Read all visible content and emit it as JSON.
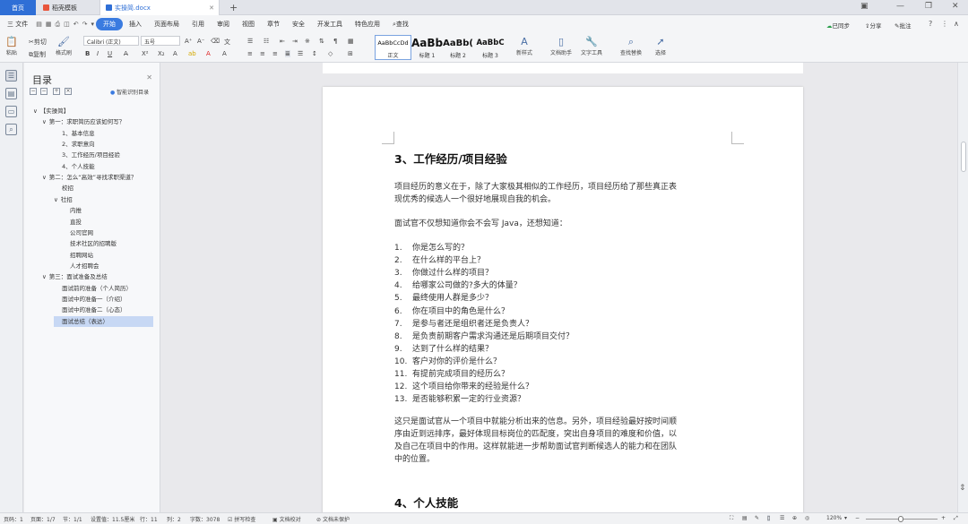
{
  "tabs": {
    "home": "首页",
    "t1": "稻壳模板",
    "t2": "实操简.docx"
  },
  "menu": {
    "file": "三 文件",
    "items": [
      "开始",
      "插入",
      "页面布局",
      "引用",
      "审阅",
      "视图",
      "章节",
      "安全",
      "开发工具",
      "特色应用"
    ],
    "search": "查找",
    "right": [
      "已同步",
      "分享",
      "批注"
    ]
  },
  "toolbar": {
    "paste": "粘贴",
    "cut": "剪切",
    "copy": "复制",
    "format_painter": "格式刷",
    "font_name": "Calibri (正文)",
    "font_size": "五号",
    "styles": [
      {
        "sample": "AaBbCcDd",
        "label": "正文"
      },
      {
        "sample": "AaBb",
        "label": "标题 1"
      },
      {
        "sample": "AaBb(",
        "label": "标题 2"
      },
      {
        "sample": "AaBbC",
        "label": "标题 3"
      }
    ],
    "new_style": "新样式",
    "doc_helper": "文档助手",
    "text_tools": "文字工具",
    "find_replace": "查找替换",
    "select": "选择"
  },
  "nav": {
    "title": "目录",
    "smart": "智能识别目录",
    "items": [
      {
        "text": "【实操简】",
        "level": 0,
        "toggle": "∨"
      },
      {
        "text": "第一：求职简历应该如何写？",
        "level": 1,
        "toggle": "∨"
      },
      {
        "text": "1、基本信息",
        "level": 2
      },
      {
        "text": "2、求职意向",
        "level": 2
      },
      {
        "text": "3、工作经历/项目经验",
        "level": 2
      },
      {
        "text": "4、个人技能",
        "level": 2
      },
      {
        "text": "第二：怎么“高效”寻找求职渠道？",
        "level": 1,
        "toggle": "∨"
      },
      {
        "text": "校招",
        "level": 2
      },
      {
        "text": "社招",
        "level": 2,
        "toggle": "∨"
      },
      {
        "text": "内推",
        "level": 3
      },
      {
        "text": "直投",
        "level": 3
      },
      {
        "text": "公司官网",
        "level": 3
      },
      {
        "text": "技术社区的招聘版",
        "level": 3
      },
      {
        "text": "招聘网站",
        "level": 3
      },
      {
        "text": "人才招聘会",
        "level": 3
      },
      {
        "text": "第三：面试准备及总结",
        "level": 1,
        "toggle": "∨"
      },
      {
        "text": "面试前的准备（个人简历）",
        "level": 2
      },
      {
        "text": "面试中的准备一（介绍）",
        "level": 2
      },
      {
        "text": "面试中的准备二（心态）",
        "level": 2
      },
      {
        "text": "面试总结（表达）",
        "level": 2,
        "selected": true
      }
    ]
  },
  "document": {
    "heading3": "3、工作经历/项目经验",
    "para1_l1": "项目经历的意义在于，除了大家极其相似的工作经历，项目经历给了那些真正表",
    "para1_l2": "现优秀的候选人一个很好地展现自我的机会。",
    "para2": "面试官不仅想知道你会不会写 Java，还想知道：",
    "list": [
      "你是怎么写的？",
      "在什么样的平台上？",
      "你做过什么样的项目？",
      "给哪家公司做的?多大的体量？",
      "最终使用人群是多少？",
      "你在项目中的角色是什么？",
      "是参与者还是组织者还是负责人？",
      "是负责前期客户需求沟通还是后期项目交付？",
      "达到了什么样的结果？",
      "客户对你的评价是什么？",
      "有提前完成项目的经历么？",
      "这个项目给你带来的经验是什么？",
      "是否能够积累一定的行业资源？"
    ],
    "para3_l1": "这只是面试官从一个项目中就能分析出来的信息。另外，项目经验最好按时间顺",
    "para3_l2": "序由近到远排序，最好体现目标岗位的匹配度，突出自身项目的难度和价值，以",
    "para3_l3": "及自己在项目中的作用。这样就能进一步帮助面试官判断候选人的能力和在团队",
    "para3_l4": "中的位置。",
    "heading4": "4、个人技能"
  },
  "status": {
    "page": "页码：1",
    "pages": "页面：1/7",
    "section": "节：1/1",
    "setting": "设置值：11.5厘米",
    "row": "行：11",
    "col": "列：2",
    "words": "字数：3078",
    "spell": "拼写检查",
    "proof": "文档校对",
    "unprotected": "文档未保护",
    "zoom": "120%"
  },
  "colors": {
    "accent": "#3a7be0",
    "selected": "#c7d8f4"
  }
}
